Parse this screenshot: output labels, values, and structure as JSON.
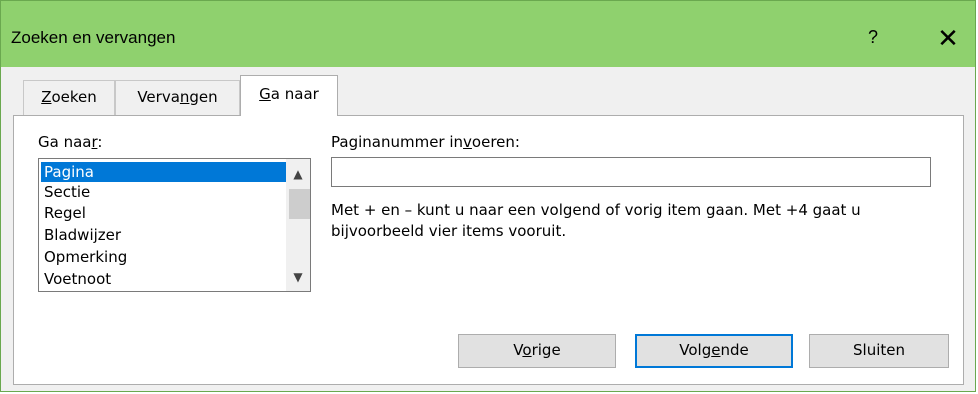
{
  "window": {
    "title": "Zoeken en vervangen",
    "help_glyph": "?",
    "close_glyph": "✕"
  },
  "tabs": [
    {
      "pre": "",
      "key": "Z",
      "post": "oeken"
    },
    {
      "pre": "Verva",
      "key": "n",
      "post": "gen"
    },
    {
      "pre": "",
      "key": "G",
      "post": "a naar"
    }
  ],
  "goto": {
    "label_pre": "Ga naa",
    "label_key": "r",
    "label_post": ":",
    "items": [
      "Pagina",
      "Sectie",
      "Regel",
      "Bladwijzer",
      "Opmerking",
      "Voetnoot"
    ],
    "selected": "Pagina",
    "scroll_up_glyph": "▲",
    "scroll_down_glyph": "▼"
  },
  "page_number": {
    "label_pre": "Paginanummer in",
    "label_key": "v",
    "label_post": "oeren:",
    "value": "",
    "hint": "Met + en – kunt u naar een volgend of vorig item gaan. Met +4 gaat u bijvoorbeeld vier items vooruit."
  },
  "buttons": {
    "previous": {
      "pre": "V",
      "key": "o",
      "post": "rige"
    },
    "next": {
      "pre": "Volg",
      "key": "e",
      "post": "nde"
    },
    "close": "Sluiten"
  }
}
